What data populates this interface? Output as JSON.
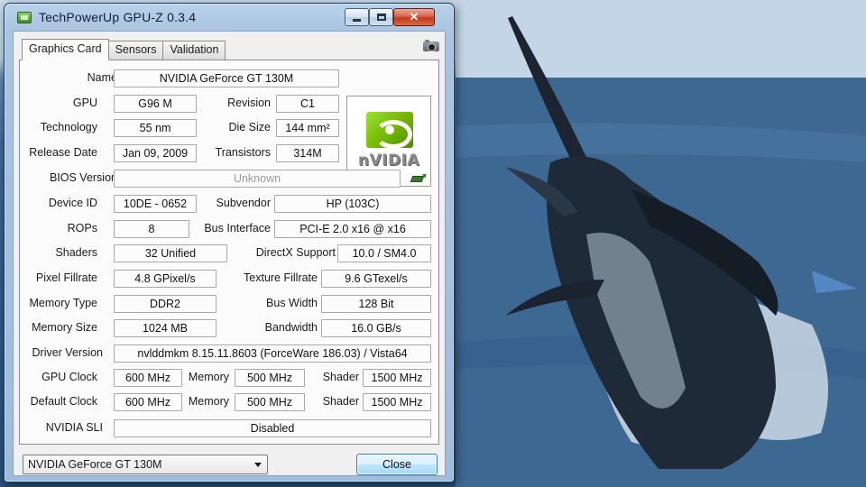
{
  "window": {
    "title": "TechPowerUp GPU-Z 0.3.4",
    "close_glyph": "✕"
  },
  "tabs": [
    {
      "label": "Graphics Card",
      "active": true
    },
    {
      "label": "Sensors",
      "active": false
    },
    {
      "label": "Validation",
      "active": false
    }
  ],
  "icons": {
    "app": "gpu-z-app-icon",
    "screenshot": "camera-icon",
    "bios_save": "bios-chip-arrow-icon",
    "logo": "nvidia-logo"
  },
  "logo": {
    "brand_text": "nVIDIA",
    "brand_color": "#76b900"
  },
  "fields": {
    "name": {
      "label": "Name",
      "value": "NVIDIA GeForce GT 130M"
    },
    "gpu": {
      "label": "GPU",
      "value": "G96 M"
    },
    "revision": {
      "label": "Revision",
      "value": "C1"
    },
    "technology": {
      "label": "Technology",
      "value": "55 nm"
    },
    "die_size": {
      "label": "Die Size",
      "value": "144 mm²"
    },
    "release_date": {
      "label": "Release Date",
      "value": "Jan 09, 2009"
    },
    "transistors": {
      "label": "Transistors",
      "value": "314M"
    },
    "bios_version": {
      "label": "BIOS Version",
      "value": "Unknown"
    },
    "device_id": {
      "label": "Device ID",
      "value": "10DE - 0652"
    },
    "subvendor": {
      "label": "Subvendor",
      "value": "HP (103C)"
    },
    "rops": {
      "label": "ROPs",
      "value": "8"
    },
    "bus_interface": {
      "label": "Bus Interface",
      "value": "PCI-E 2.0 x16 @ x16"
    },
    "shaders": {
      "label": "Shaders",
      "value": "32 Unified"
    },
    "directx": {
      "label": "DirectX Support",
      "value": "10.0 / SM4.0"
    },
    "pixel_fillrate": {
      "label": "Pixel Fillrate",
      "value": "4.8 GPixel/s"
    },
    "texture_fillrate": {
      "label": "Texture Fillrate",
      "value": "9.6 GTexel/s"
    },
    "memory_type": {
      "label": "Memory Type",
      "value": "DDR2"
    },
    "bus_width": {
      "label": "Bus Width",
      "value": "128 Bit"
    },
    "memory_size": {
      "label": "Memory Size",
      "value": "1024 MB"
    },
    "bandwidth": {
      "label": "Bandwidth",
      "value": "16.0 GB/s"
    },
    "driver_version": {
      "label": "Driver Version",
      "value": "nvlddmkm 8.15.11.8603 (ForceWare 186.03) / Vista64"
    },
    "gpu_clock": {
      "label": "GPU Clock",
      "value": "600 MHz",
      "memory_label": "Memory",
      "memory": "500 MHz",
      "shader_label": "Shader",
      "shader": "1500 MHz"
    },
    "default_clock": {
      "label": "Default Clock",
      "value": "600 MHz",
      "memory_label": "Memory",
      "memory": "500 MHz",
      "shader_label": "Shader",
      "shader": "1500 MHz"
    },
    "sli": {
      "label": "NVIDIA SLI",
      "value": "Disabled"
    }
  },
  "footer": {
    "selected_gpu": "NVIDIA GeForce GT 130M",
    "close_label": "Close"
  }
}
